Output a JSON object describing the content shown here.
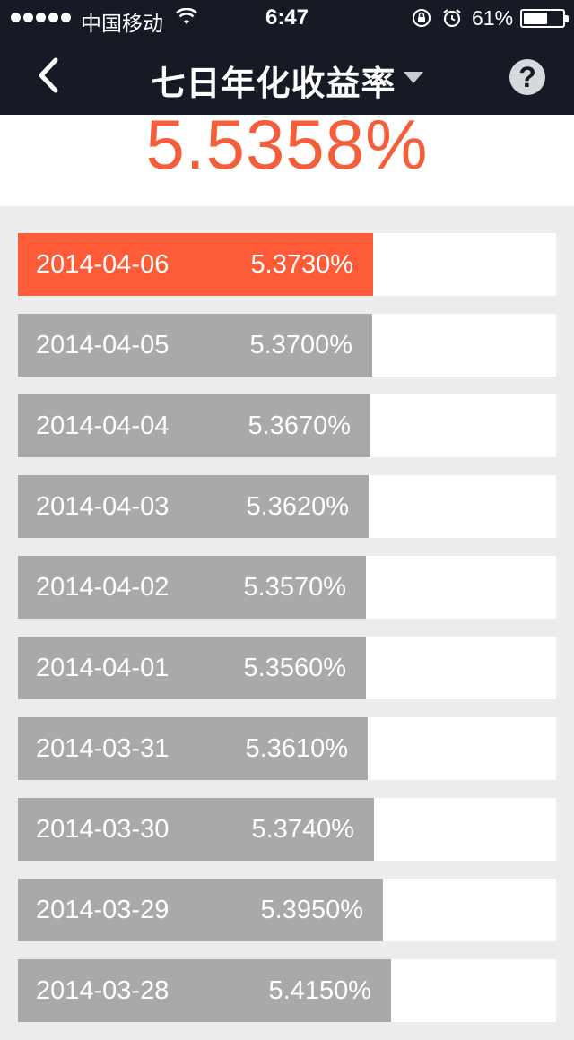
{
  "status_bar": {
    "carrier": "中国移动",
    "time": "6:47",
    "battery_percent": "61%",
    "battery_level": 0.61
  },
  "nav": {
    "title": "七日年化收益率",
    "back_icon": "chevron-left-icon",
    "dropdown_icon": "caret-down-icon",
    "help_label": "?"
  },
  "summary": {
    "rate": "5.5358%"
  },
  "colors": {
    "accent": "#fe5b38",
    "inactive_bar": "#a9a9a9",
    "nav_bg": "#161a24",
    "page_bg": "#ecedef",
    "rate_text": "#f55e3a"
  },
  "history": {
    "rows": [
      {
        "date": "2014-04-06",
        "rate": "5.3730%",
        "value": 5.373,
        "active": true
      },
      {
        "date": "2014-04-05",
        "rate": "5.3700%",
        "value": 5.37,
        "active": false
      },
      {
        "date": "2014-04-04",
        "rate": "5.3670%",
        "value": 5.367,
        "active": false
      },
      {
        "date": "2014-04-03",
        "rate": "5.3620%",
        "value": 5.362,
        "active": false
      },
      {
        "date": "2014-04-02",
        "rate": "5.3570%",
        "value": 5.357,
        "active": false
      },
      {
        "date": "2014-04-01",
        "rate": "5.3560%",
        "value": 5.356,
        "active": false
      },
      {
        "date": "2014-03-31",
        "rate": "5.3610%",
        "value": 5.361,
        "active": false
      },
      {
        "date": "2014-03-30",
        "rate": "5.3740%",
        "value": 5.374,
        "active": false
      },
      {
        "date": "2014-03-29",
        "rate": "5.3950%",
        "value": 5.395,
        "active": false
      },
      {
        "date": "2014-03-28",
        "rate": "5.4150%",
        "value": 5.415,
        "active": false
      }
    ]
  }
}
